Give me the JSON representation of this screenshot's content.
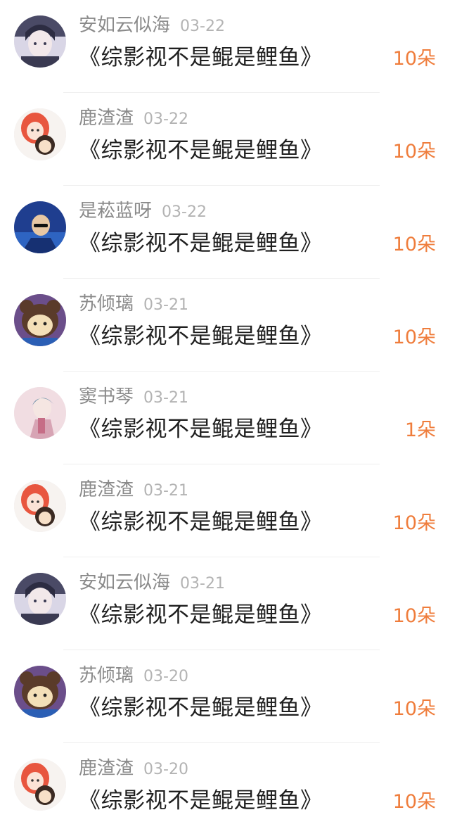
{
  "items": [
    {
      "user": "安如云似海",
      "date": "03-22",
      "title": "《综影视不是鲲是鲤鱼》",
      "gift": "10朵",
      "avatar": "avatar-boy-dark"
    },
    {
      "user": "鹿渣渣",
      "date": "03-22",
      "title": "《综影视不是鲲是鲤鱼》",
      "gift": "10朵",
      "avatar": "avatar-redhair"
    },
    {
      "user": "是菘蓝呀",
      "date": "03-22",
      "title": "《综影视不是鲲是鲤鱼》",
      "gift": "10朵",
      "avatar": "avatar-blue"
    },
    {
      "user": "苏倾璃",
      "date": "03-21",
      "title": "《综影视不是鲲是鲤鱼》",
      "gift": "10朵",
      "avatar": "avatar-bear"
    },
    {
      "user": "窦书琴",
      "date": "03-21",
      "title": "《综影视不是鲲是鲤鱼》",
      "gift": "1朵",
      "avatar": "avatar-pink"
    },
    {
      "user": "鹿渣渣",
      "date": "03-21",
      "title": "《综影视不是鲲是鲤鱼》",
      "gift": "10朵",
      "avatar": "avatar-redhair"
    },
    {
      "user": "安如云似海",
      "date": "03-21",
      "title": "《综影视不是鲲是鲤鱼》",
      "gift": "10朵",
      "avatar": "avatar-boy-dark"
    },
    {
      "user": "苏倾璃",
      "date": "03-20",
      "title": "《综影视不是鲲是鲤鱼》",
      "gift": "10朵",
      "avatar": "avatar-bear"
    },
    {
      "user": "鹿渣渣",
      "date": "03-20",
      "title": "《综影视不是鲲是鲤鱼》",
      "gift": "10朵",
      "avatar": "avatar-redhair"
    }
  ],
  "colors": {
    "gift": "#ef7d3c",
    "username": "#8a8a8a",
    "date": "#b3b3b3",
    "title": "#1f1f1f",
    "divider": "#efefef"
  }
}
